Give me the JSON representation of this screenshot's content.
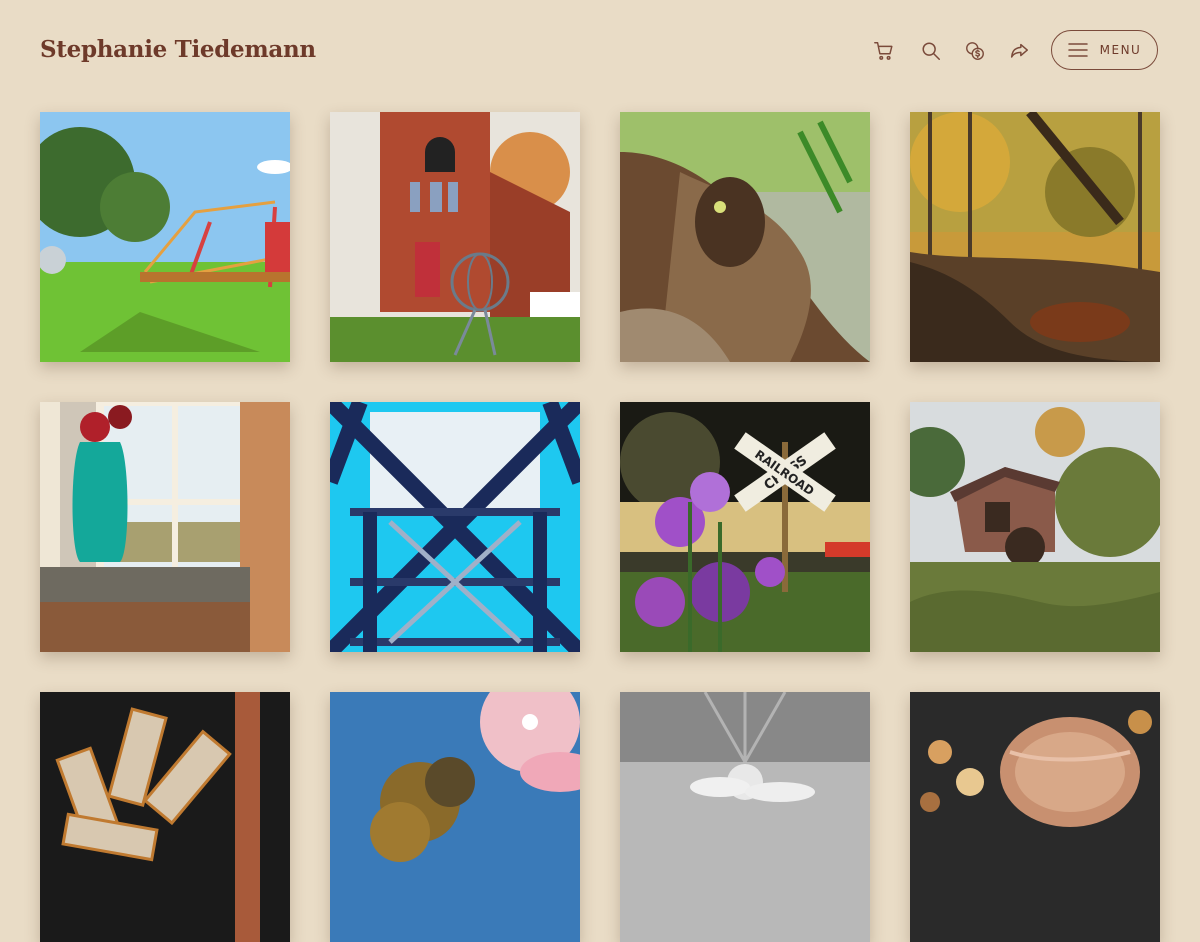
{
  "header": {
    "site_title": "Stephanie Tiedemann",
    "icons": [
      "cart-icon",
      "search-icon",
      "currency-icon",
      "share-icon",
      "menu-icon"
    ],
    "menu_label": "MENU"
  },
  "colors": {
    "background": "#e9dcc6",
    "title": "#6e3a2a",
    "icon": "#7a4a3a"
  },
  "gallery": {
    "photos": [
      {
        "subject": "playground"
      },
      {
        "subject": "brick-church-armillary"
      },
      {
        "subject": "tree-stump"
      },
      {
        "subject": "autumn-creek"
      },
      {
        "subject": "window-blue-vase"
      },
      {
        "subject": "steel-bridge"
      },
      {
        "subject": "railroad-crossing-wildflowers"
      },
      {
        "subject": "old-mill"
      },
      {
        "subject": "rusty-windmill"
      },
      {
        "subject": "sunset-tree"
      },
      {
        "subject": "black-white-sky"
      },
      {
        "subject": "shell-closeup"
      }
    ],
    "photo_texts": {
      "railroad_sign_1": "CROSS",
      "railroad_sign_2": "RAILROAD"
    }
  }
}
